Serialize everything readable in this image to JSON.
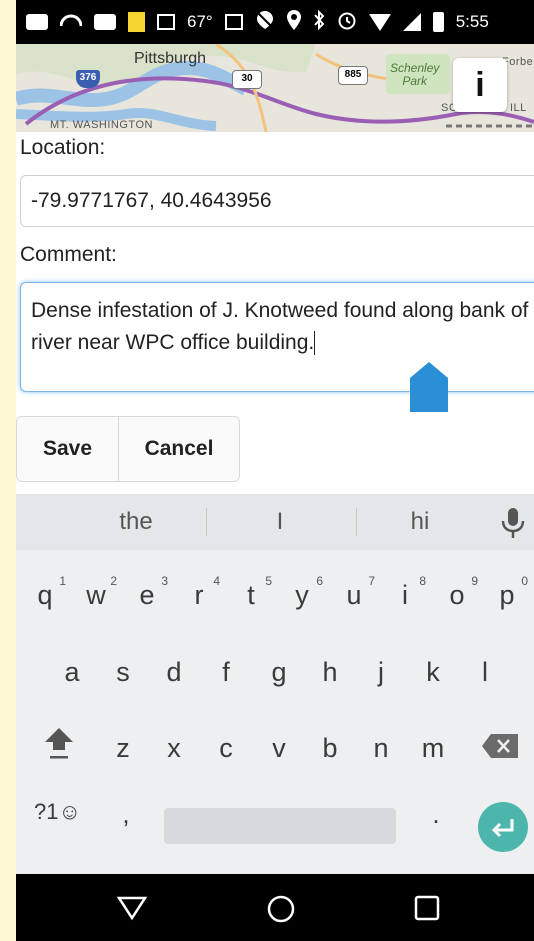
{
  "status_bar": {
    "temperature": "67°",
    "time": "5:55"
  },
  "map": {
    "city_label": "Pittsburgh",
    "neighborhood_label": "MT. WASHINGTON",
    "park_label_line1": "Schenley",
    "park_label_line2": "Park",
    "edge_label_top": "Forbe",
    "edge_label_mid": "SC",
    "edge_label_right": "ILL",
    "shield_376": "376",
    "shield_30": "30",
    "shield_885": "885",
    "info_button_label": "i"
  },
  "form": {
    "location_label": "Location:",
    "location_value": "-79.9771767, 40.4643956",
    "comment_label": "Comment:",
    "comment_value": "Dense infestation of J. Knotweed found along bank of river near WPC office building.",
    "save_label": "Save",
    "cancel_label": "Cancel"
  },
  "keyboard": {
    "suggestions": [
      "the",
      "I",
      "hi"
    ],
    "row1": [
      {
        "key": "q",
        "hint": "1"
      },
      {
        "key": "w",
        "hint": "2"
      },
      {
        "key": "e",
        "hint": "3"
      },
      {
        "key": "r",
        "hint": "4"
      },
      {
        "key": "t",
        "hint": "5"
      },
      {
        "key": "y",
        "hint": "6"
      },
      {
        "key": "u",
        "hint": "7"
      },
      {
        "key": "i",
        "hint": "8"
      },
      {
        "key": "o",
        "hint": "9"
      },
      {
        "key": "p",
        "hint": "0"
      }
    ],
    "row2": [
      "a",
      "s",
      "d",
      "f",
      "g",
      "h",
      "j",
      "k",
      "l"
    ],
    "row3": [
      "z",
      "x",
      "c",
      "v",
      "b",
      "n",
      "m"
    ],
    "symbols_label": "?1☺",
    "comma_label": ",",
    "period_label": ".",
    "accent_color": "#4db6ac"
  },
  "icons": {
    "status_bar": [
      "message-icon",
      "cast-icon",
      "chat-icon",
      "note-icon",
      "image-icon",
      "photo-icon",
      "location-off-icon",
      "location-icon",
      "bluetooth-icon",
      "alarm-icon",
      "wifi-icon",
      "signal-icon",
      "battery-icon"
    ],
    "nav_bar": [
      "back-icon",
      "home-icon",
      "recents-icon"
    ]
  }
}
